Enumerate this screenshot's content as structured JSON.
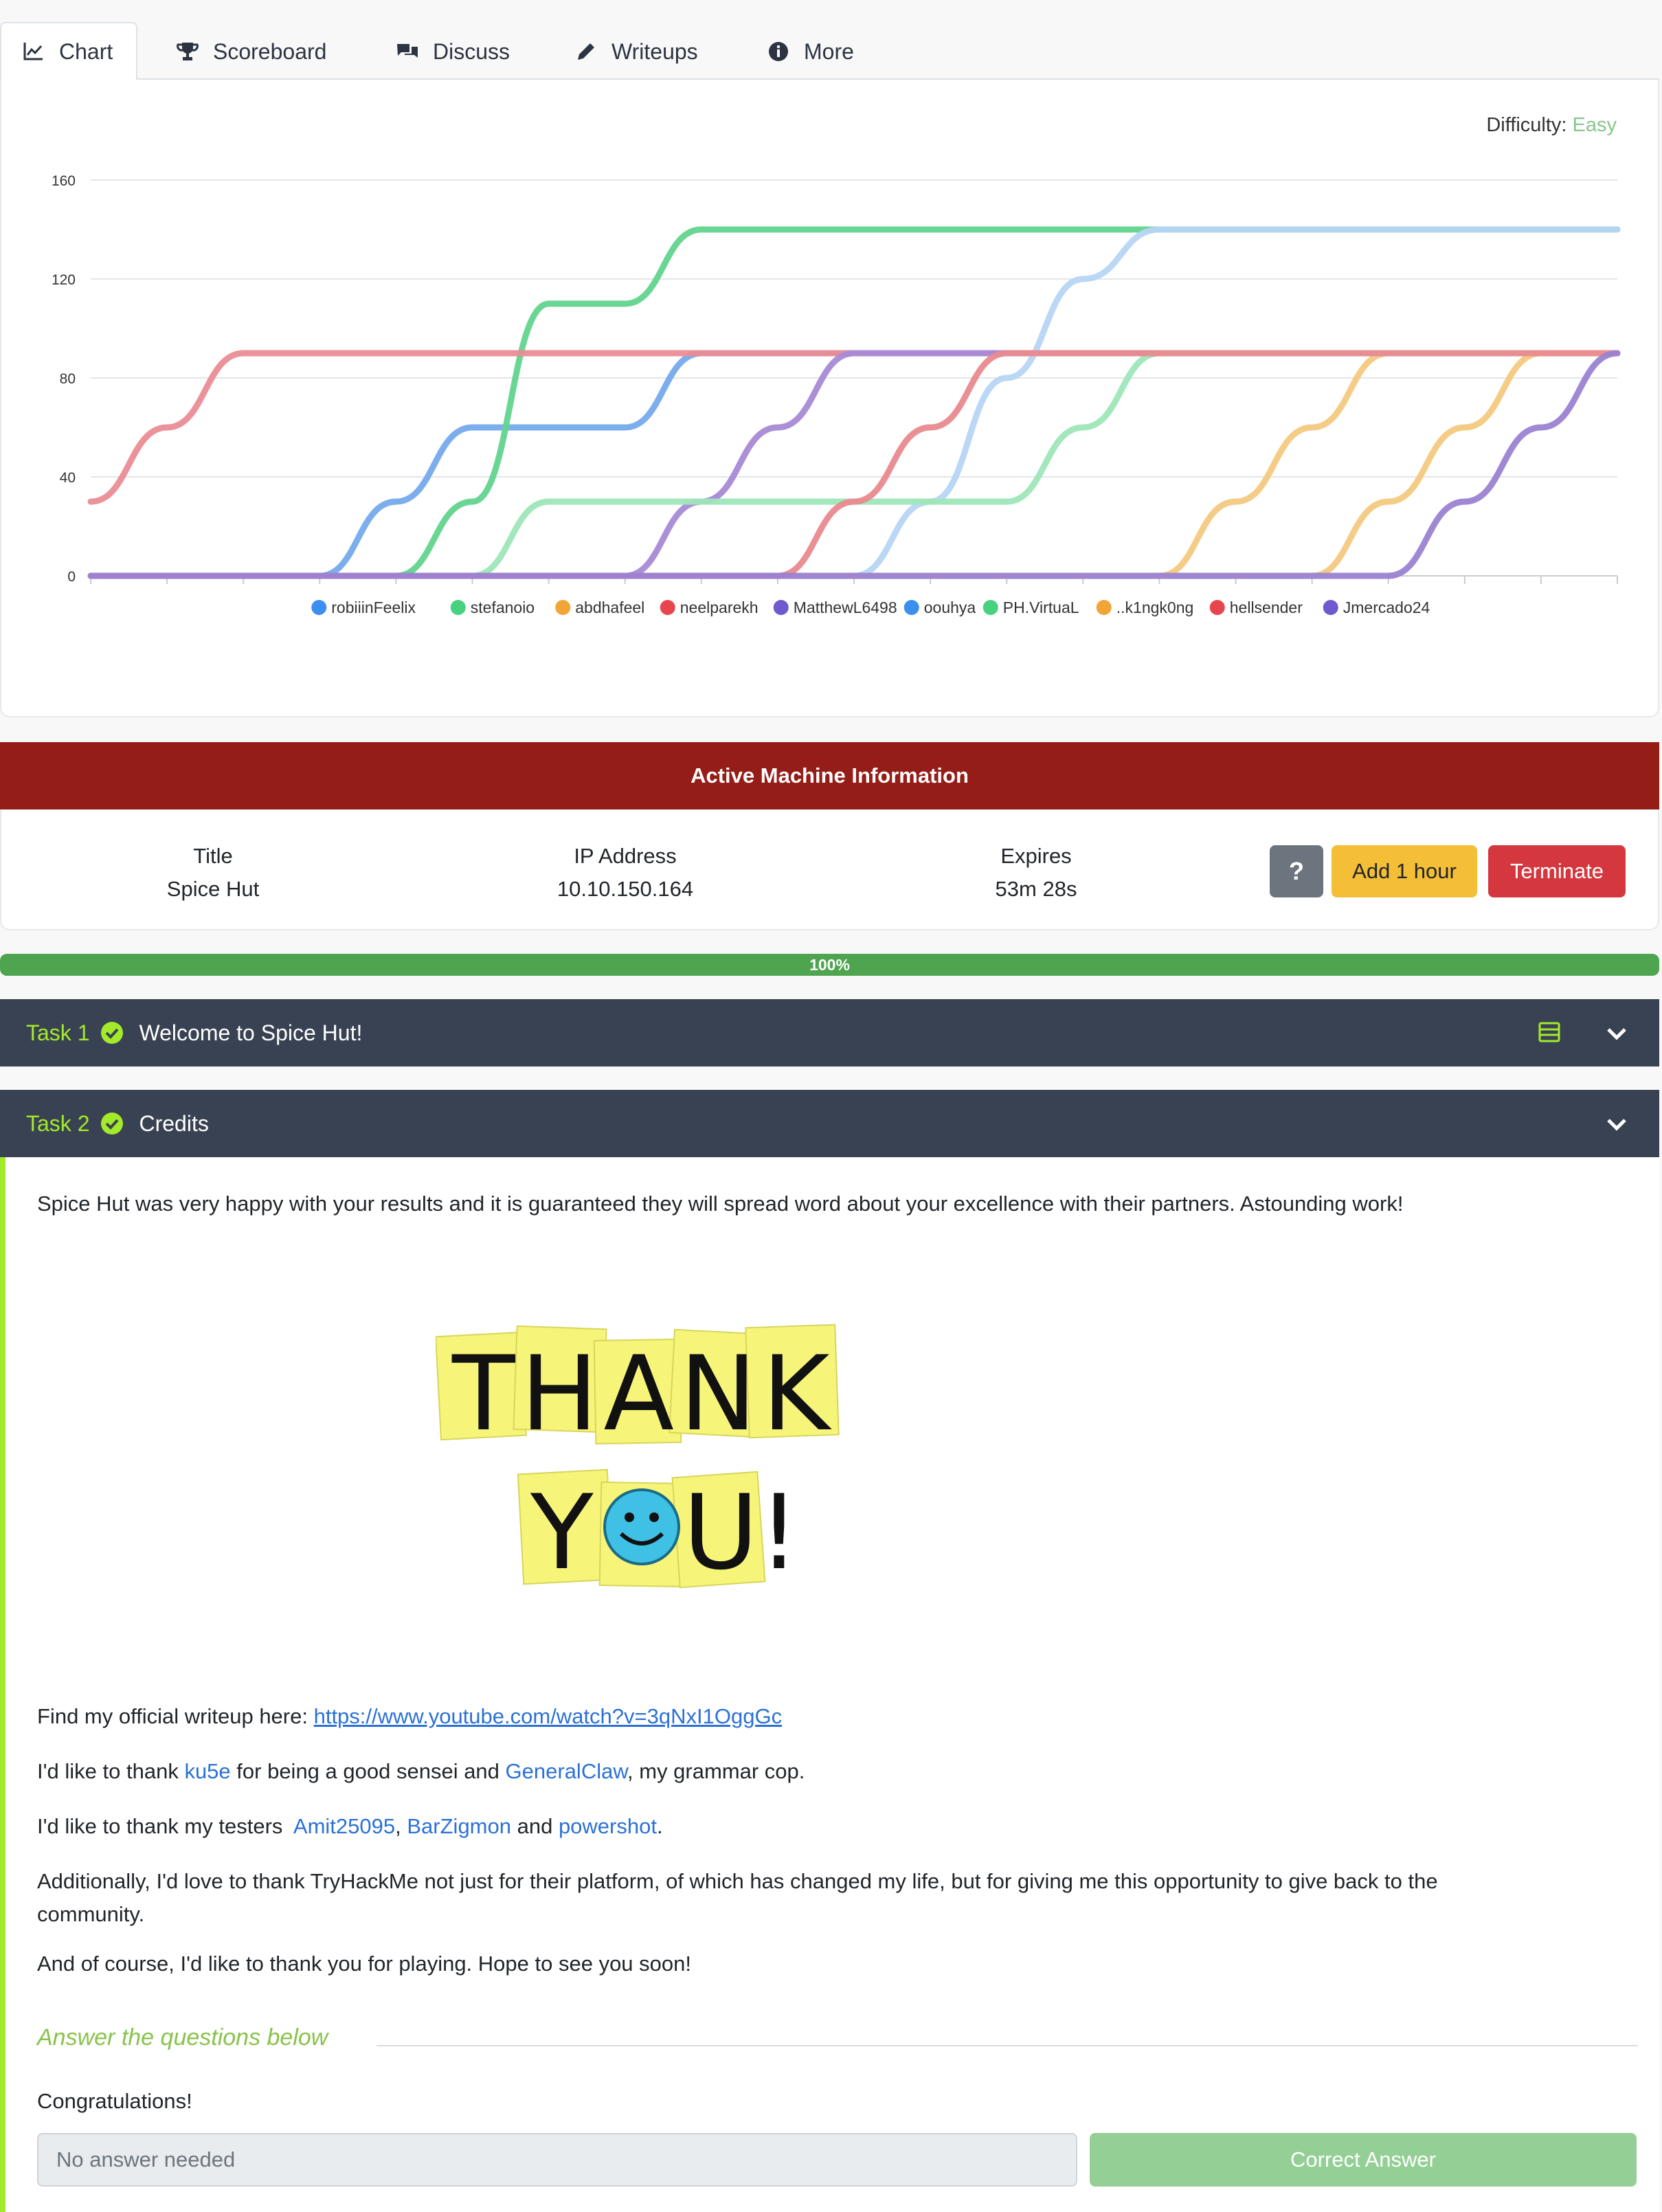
{
  "tabs": [
    {
      "label": "Chart",
      "icon": "chart-line-icon",
      "active": true
    },
    {
      "label": "Scoreboard",
      "icon": "trophy-icon",
      "active": false
    },
    {
      "label": "Discuss",
      "icon": "comments-icon",
      "active": false
    },
    {
      "label": "Writeups",
      "icon": "pencil-icon",
      "active": false
    },
    {
      "label": "More",
      "icon": "info-circle-icon",
      "active": false
    }
  ],
  "difficulty": {
    "label": "Difficulty:",
    "value": "Easy",
    "color": "#88c58b"
  },
  "chart_data": {
    "type": "line",
    "title": "",
    "xlabel": "",
    "ylabel": "",
    "ylim": [
      0,
      160
    ],
    "y_ticks": [
      "0",
      "40",
      "80",
      "120",
      "160"
    ],
    "x": [
      0,
      1,
      2,
      3,
      4,
      5,
      6,
      7,
      8,
      9,
      10,
      11,
      12,
      13,
      14,
      15,
      16,
      17,
      18,
      19,
      20
    ],
    "grid": true,
    "legend_position": "bottom",
    "series": [
      {
        "name": "robiiinFeelix",
        "color": "#3b8fef",
        "marker": "#3b8fef",
        "line": "#75aaec",
        "values": [
          0,
          0,
          0,
          0,
          30,
          60,
          60,
          60,
          90,
          90,
          90,
          90,
          90,
          90,
          90,
          90,
          90,
          90,
          90,
          90,
          90
        ]
      },
      {
        "name": "stefanoio",
        "color": "#48d17f",
        "marker": "#48d17f",
        "line": "#62d48e",
        "values": [
          0,
          0,
          0,
          0,
          0,
          30,
          110,
          110,
          140,
          140,
          140,
          140,
          140,
          140,
          140,
          140,
          140,
          140,
          140,
          140,
          140
        ]
      },
      {
        "name": "abdhafeel",
        "color": "#f2a537",
        "marker": "#f2a537",
        "line": "#f4c97f",
        "values": [
          0,
          0,
          0,
          0,
          0,
          0,
          0,
          0,
          0,
          0,
          0,
          0,
          0,
          0,
          0,
          30,
          60,
          90,
          90,
          90,
          90
        ]
      },
      {
        "name": "neelparekh",
        "color": "#e8464f",
        "marker": "#e8464f",
        "line": "#ea8c95",
        "values": [
          30,
          60,
          90,
          90,
          90,
          90,
          90,
          90,
          90,
          90,
          90,
          90,
          90,
          90,
          90,
          90,
          90,
          90,
          90,
          90,
          90
        ]
      },
      {
        "name": "MatthewL6498",
        "color": "#6f59ce",
        "marker": "#6f59ce",
        "line": "#a78ad6",
        "values": [
          0,
          0,
          0,
          0,
          0,
          0,
          0,
          0,
          30,
          60,
          90,
          90,
          90,
          90,
          90,
          90,
          90,
          90,
          90,
          90,
          90
        ]
      },
      {
        "name": "oouhya",
        "color": "#3b8fef",
        "marker": "#3b8fef",
        "line": "#b7d5f5",
        "values": [
          0,
          0,
          0,
          0,
          0,
          0,
          0,
          0,
          0,
          0,
          0,
          30,
          80,
          120,
          140,
          140,
          140,
          140,
          140,
          140,
          140
        ]
      },
      {
        "name": "PH.VirtuaL",
        "color": "#48d17f",
        "marker": "#48d17f",
        "line": "#9ee6b8",
        "values": [
          0,
          0,
          0,
          0,
          0,
          0,
          30,
          30,
          30,
          30,
          30,
          30,
          30,
          60,
          90,
          90,
          90,
          90,
          90,
          90,
          90
        ]
      },
      {
        "name": "..k1ngk0ng",
        "color": "#f2a537",
        "marker": "#f2a537",
        "line": "#f4c97f",
        "values": [
          0,
          0,
          0,
          0,
          0,
          0,
          0,
          0,
          0,
          0,
          0,
          0,
          0,
          0,
          0,
          0,
          0,
          30,
          60,
          90,
          90
        ]
      },
      {
        "name": "hellsender",
        "color": "#e8464f",
        "marker": "#e8464f",
        "line": "#e98a8f",
        "values": [
          0,
          0,
          0,
          0,
          0,
          0,
          0,
          0,
          0,
          0,
          30,
          60,
          90,
          90,
          90,
          90,
          90,
          90,
          90,
          90,
          90
        ]
      },
      {
        "name": "Jmercado24",
        "color": "#6f59ce",
        "marker": "#6f59ce",
        "line": "#9a82d2",
        "values": [
          0,
          0,
          0,
          0,
          0,
          0,
          0,
          0,
          0,
          0,
          0,
          0,
          0,
          0,
          0,
          0,
          0,
          0,
          30,
          60,
          90
        ]
      }
    ]
  },
  "active_machine": {
    "header": "Active Machine Information",
    "title_label": "Title",
    "title_value": "Spice Hut",
    "ip_label": "IP Address",
    "ip_value": "10.10.150.164",
    "expires_label": "Expires",
    "expires_value": "53m 28s",
    "help_label": "?",
    "add_label": "Add 1 hour",
    "terminate_label": "Terminate"
  },
  "progress": {
    "value": 1.0,
    "label": "100%"
  },
  "tasks": [
    {
      "num": "Task 1",
      "title": "Welcome to Spice Hut!"
    },
    {
      "num": "Task 2",
      "title": "Credits"
    }
  ],
  "task2": {
    "intro": "Spice Hut was very happy with your results and it is guaranteed they will spread word about your excellence with their partners. Astounding work!",
    "image_text_line1": "THANK",
    "image_text_line2": "YOU!",
    "writeup_prefix": "Find my official writeup here: ",
    "writeup_link": "https://www.youtube.com/watch?v=3qNxI1OggGc",
    "thanks1_a": "I'd like to thank ",
    "thanks1_link1": "ku5e",
    "thanks1_b": " for being a good sensei and ",
    "thanks1_link2": "GeneralClaw",
    "thanks1_c": ", my grammar cop.",
    "thanks2_a": "I'd like to thank my testers  ",
    "thanks2_link1": "Amit25095",
    "thanks2_sep": ", ",
    "thanks2_link2": "BarZigmon",
    "thanks2_and": " and ",
    "thanks2_link3": "powershot",
    "thanks2_end": ".",
    "additional_line1": "Additionally, I'd love to thank TryHackMe not just for their platform, of which has changed my life, but for giving me this opportunity to give back to the",
    "additional_line2": "community.",
    "closing": "And of course, I'd like to thank you for playing. Hope to see you soon!",
    "answer_title": "Answer the questions below",
    "question": "Congratulations!",
    "answer_placeholder": "No answer needed",
    "answer_button": "Correct Answer"
  }
}
